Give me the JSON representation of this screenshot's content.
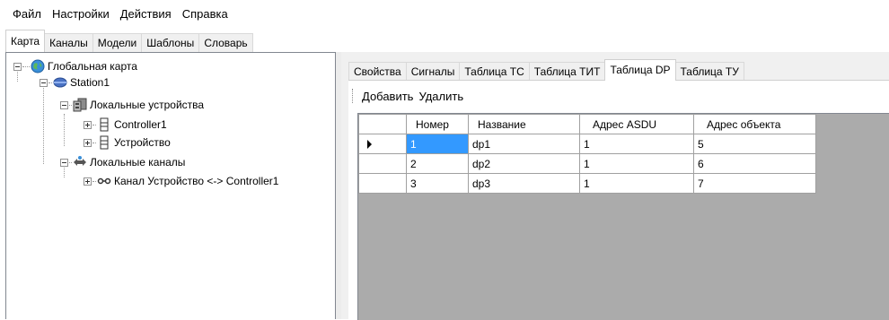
{
  "menu": [
    "Файл",
    "Настройки",
    "Действия",
    "Справка"
  ],
  "main_tabs": [
    "Карта",
    "Каналы",
    "Модели",
    "Шаблоны",
    "Словарь"
  ],
  "active_main_tab": "Карта",
  "tree": {
    "root": "Глобальная карта",
    "station": "Station1",
    "local_devices": "Локальные устройства",
    "controller": "Controller1",
    "device": "Устройство",
    "local_channels": "Локальные каналы",
    "channel": "Канал Устройство <-> Controller1"
  },
  "sub_tabs": [
    "Свойства",
    "Сигналы",
    "Таблица ТС",
    "Таблица ТИТ",
    "Таблица DP",
    "Таблица ТУ"
  ],
  "active_sub_tab": "Таблица DP",
  "toolbar": {
    "add": "Добавить",
    "delete": "Удалить"
  },
  "grid": {
    "columns": [
      "Номер",
      "Название",
      "Адрес ASDU",
      "Адрес объекта"
    ],
    "rows": [
      [
        "1",
        "dp1",
        "1",
        "5"
      ],
      [
        "2",
        "dp2",
        "1",
        "6"
      ],
      [
        "3",
        "dp3",
        "1",
        "7"
      ]
    ],
    "selected_row": 0
  },
  "colors": {
    "selection": "#3399ff",
    "grid_bg": "#ababab",
    "panel_bg": "#f0f0f0"
  }
}
